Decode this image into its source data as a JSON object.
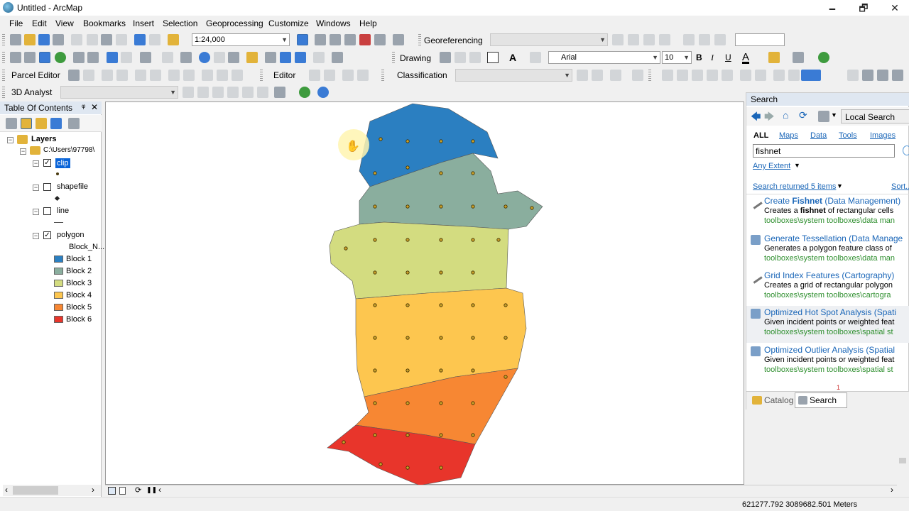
{
  "window": {
    "title": "Untitled - ArcMap",
    "minimize": "🗕",
    "maximize": "🗗",
    "close": "✕"
  },
  "menu": [
    "File",
    "Edit",
    "View",
    "Bookmarks",
    "Insert",
    "Selection",
    "Geoprocessing",
    "Customize",
    "Windows",
    "Help"
  ],
  "standard_toolbar": {
    "scale": "1:24,000"
  },
  "georef_toolbar": {
    "label": "Georeferencing"
  },
  "drawing_toolbar": {
    "label": "Drawing",
    "font": "Arial",
    "size": "10",
    "bold": "B",
    "italic": "I",
    "underline": "U",
    "text_tool": "A"
  },
  "parcel_toolbar": {
    "label": "Parcel Editor"
  },
  "editor_toolbar": {
    "label": "Editor"
  },
  "classification_toolbar": {
    "label": "Classification"
  },
  "analyst_toolbar": {
    "label": "3D Analyst"
  },
  "toc": {
    "title": "Table Of Contents",
    "pin": "ᵠ",
    "close": "✕",
    "root": "Layers",
    "folder": "C:\\Users\\97798\\",
    "layers": [
      {
        "name": "clip",
        "checked": true,
        "selected": true
      },
      {
        "name": "shapefile",
        "checked": false
      },
      {
        "name": "line",
        "checked": false
      },
      {
        "name": "polygon",
        "checked": true
      }
    ],
    "polygon_field": "Block_N...",
    "classes": [
      {
        "label": "Block 1",
        "color": "#2b7fc1"
      },
      {
        "label": "Block 2",
        "color": "#8aae9e"
      },
      {
        "label": "Block 3",
        "color": "#d3dc80"
      },
      {
        "label": "Block 4",
        "color": "#fdc64f"
      },
      {
        "label": "Block 5",
        "color": "#f78733"
      },
      {
        "label": "Block 6",
        "color": "#e8352b"
      }
    ]
  },
  "search": {
    "title": "Search",
    "scope": "Local Search",
    "tabs": [
      "ALL",
      "Maps",
      "Data",
      "Tools",
      "Images"
    ],
    "query": "fishnet",
    "extent": "Any Extent",
    "returned": "Search returned 5 items",
    "sort": "Sort...",
    "results": [
      {
        "title_pre": "Create ",
        "title_bold": "Fishnet",
        "title_post": " (Data Management)",
        "desc_pre": "Creates a ",
        "desc_bold": "fishnet",
        "desc_post": " of rectangular cells",
        "path": "toolboxes\\system toolboxes\\data man"
      },
      {
        "title_pre": "Generate Tessellation (Data Manage",
        "title_bold": "",
        "title_post": "",
        "desc_pre": "Generates a polygon feature class of",
        "desc_bold": "",
        "desc_post": "",
        "path": "toolboxes\\system toolboxes\\data man"
      },
      {
        "title_pre": "Grid Index Features (Cartography)",
        "title_bold": "",
        "title_post": "",
        "desc_pre": "Creates a grid of rectangular polygon",
        "desc_bold": "",
        "desc_post": "",
        "path": "toolboxes\\system toolboxes\\cartogra"
      },
      {
        "title_pre": "Optimized Hot Spot Analysis (Spati",
        "title_bold": "",
        "title_post": "",
        "desc_pre": "Given incident points or weighted feat",
        "desc_bold": "",
        "desc_post": "",
        "path": "toolboxes\\system toolboxes\\spatial st"
      },
      {
        "title_pre": "Optimized Outlier Analysis (Spatial",
        "title_bold": "",
        "title_post": "",
        "desc_pre": "Given incident points or weighted feat",
        "desc_bold": "",
        "desc_post": "",
        "path": "toolboxes\\system toolboxes\\spatial st"
      }
    ],
    "page_number": "1",
    "bottom_tabs": [
      "Catalog",
      "Search"
    ]
  },
  "status": {
    "coords": "621277.792  3089682.501 Meters"
  }
}
